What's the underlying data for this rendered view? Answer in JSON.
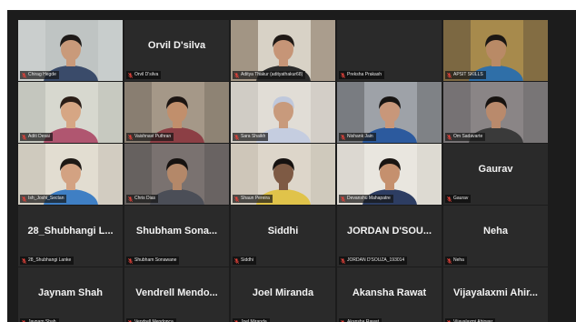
{
  "tiles": [
    {
      "name": "Chirag Hegde",
      "video": true,
      "speaking": true,
      "bg": "#cfd3d2",
      "wall": "#bfc4c3",
      "shirt": "#3a4b6a",
      "skin": "#c99a7a",
      "hair": "#1e1a18"
    },
    {
      "name": "Orvil D'silva",
      "video": false,
      "display": "Orvil D'silva"
    },
    {
      "name": "Aditya Thakur (adityathakur68)",
      "video": true,
      "bg": "#8c7a68",
      "wall": "#d8d2c6",
      "shirt": "#2b2b2b",
      "skin": "#c69577",
      "hair": "#201a16"
    },
    {
      "name": "Preksha Prakash",
      "video": false,
      "display": ""
    },
    {
      "name": "APSIT SKILLS",
      "video": true,
      "bg": "#6a5a3e",
      "wall": "#a78a4c",
      "shirt": "#2f6fa8",
      "skin": "#b98a66",
      "hair": "#1b1714"
    },
    {
      "name": "Aditi Desai",
      "video": true,
      "bg": "#bcbfb6",
      "wall": "#d7d8cf",
      "shirt": "#b05670",
      "skin": "#d6a684",
      "hair": "#2a1d17"
    },
    {
      "name": "Vaishnavi Puthran",
      "video": true,
      "bg": "#7e7468",
      "wall": "#a59888",
      "shirt": "#8c3f45",
      "skin": "#c18f6c",
      "hair": "#1c1512"
    },
    {
      "name": "Sara Shaikh",
      "video": true,
      "bg": "#c9c4bd",
      "wall": "#e1ddd6",
      "shirt": "#c5cde0",
      "skin": "#c89a7c",
      "hair": "#bfc8dc"
    },
    {
      "name": "Nishank Jain",
      "video": true,
      "bg": "#6a6c70",
      "wall": "#9ea2a8",
      "shirt": "#2c5a9e",
      "skin": "#c8977a",
      "hair": "#171412"
    },
    {
      "name": "Om Sadavarte",
      "video": true,
      "bg": "#6d6a6c",
      "wall": "#8a8586",
      "shirt": "#3a3a3a",
      "skin": "#b98a6c",
      "hair": "#171310"
    },
    {
      "name": "Ish_Joshi_Sectan",
      "video": true,
      "bg": "#c8c2b6",
      "wall": "#e2ddd1",
      "shirt": "#3f7fc4",
      "skin": "#d3a282",
      "hair": "#1e1915"
    },
    {
      "name": "Chris Dias",
      "video": true,
      "bg": "#5e5a58",
      "wall": "#7a7270",
      "shirt": "#4b4e57",
      "skin": "#b48869",
      "hair": "#161210"
    },
    {
      "name": "Shaun Pereira",
      "video": true,
      "bg": "#c7bfb2",
      "wall": "#ddd6ca",
      "shirt": "#e0c34a",
      "skin": "#7e5a44",
      "hair": "#161210"
    },
    {
      "name": "Devanshu Mahapatre",
      "video": true,
      "bg": "#d6d2ca",
      "wall": "#e9e6df",
      "shirt": "#2d3d62",
      "skin": "#c5906e",
      "hair": "#1a1512"
    },
    {
      "name": "Gaurav",
      "video": false,
      "display": "Gaurav"
    },
    {
      "name": "28_Shubhangi Lanke",
      "video": false,
      "display": "28_Shubhangi L..."
    },
    {
      "name": "Shubham Sonawane",
      "video": false,
      "display": "Shubham Sona..."
    },
    {
      "name": "Siddhi",
      "video": false,
      "display": "Siddhi"
    },
    {
      "name": "JORDAN D'SOUZA_193014",
      "video": false,
      "display": "JORDAN D'SOU..."
    },
    {
      "name": "Neha",
      "video": false,
      "display": "Neha"
    },
    {
      "name": "Jaynam Shah",
      "video": false,
      "display": "Jaynam Shah"
    },
    {
      "name": "Vendrell Mendonca",
      "video": false,
      "display": "Vendrell Mendo..."
    },
    {
      "name": "Joel Miranda",
      "video": false,
      "display": "Joel Miranda"
    },
    {
      "name": "Akansha Rawat",
      "video": false,
      "display": "Akansha Rawat"
    },
    {
      "name": "Vijayalaxmi Ahirwar",
      "video": false,
      "display": "Vijayalaxmi Ahir..."
    }
  ],
  "colors": {
    "mic_off": "#e0423a",
    "speaker_outline": "#e6e25a"
  }
}
